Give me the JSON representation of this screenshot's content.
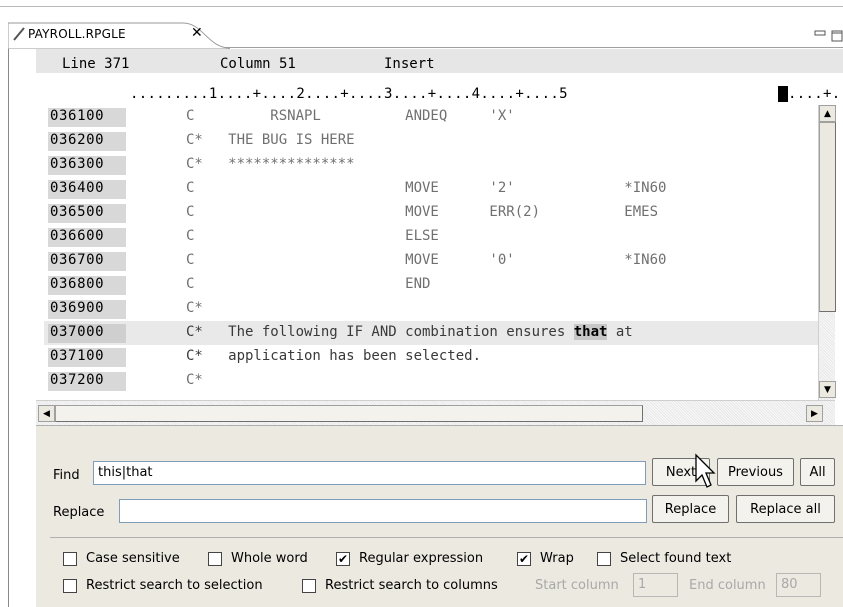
{
  "tab": {
    "title": "PAYROLL.RPGLE",
    "close": "✕"
  },
  "status": {
    "line": "Line 371",
    "column": "Column 51",
    "mode": "Insert"
  },
  "ruler": ".........1....+....2....+....3....+....4....+....5",
  "ruler_tail": "....+...",
  "code_lines": [
    {
      "seq": "036100",
      "text": "C         RSNAPL          ANDEQ     'X'"
    },
    {
      "seq": "036200",
      "text": "C*   THE BUG IS HERE"
    },
    {
      "seq": "036300",
      "text": "C*   ***************"
    },
    {
      "seq": "036400",
      "text": "C                         MOVE      '2'             *IN60"
    },
    {
      "seq": "036500",
      "text": "C                         MOVE      ERR(2)          EMES"
    },
    {
      "seq": "036600",
      "text": "C                         ELSE"
    },
    {
      "seq": "036700",
      "text": "C                         MOVE      '0'             *IN60"
    },
    {
      "seq": "036800",
      "text": "C                         END"
    },
    {
      "seq": "036900",
      "text": "C*"
    },
    {
      "seq": "037000",
      "text_before": "C*   The following IF AND combination ensures ",
      "text_match": "that",
      "text_after": " at"
    },
    {
      "seq": "037100",
      "text": "C*   application has been selected."
    },
    {
      "seq": "037200",
      "text": "C*"
    }
  ],
  "find": {
    "find_label": "Find",
    "find_value": "this|that",
    "replace_label": "Replace",
    "replace_value": "",
    "next_button": "Next",
    "previous_button": "Previous",
    "all_button": "All",
    "replace_button": "Replace",
    "replace_all_button": "Replace all"
  },
  "options": {
    "case_sensitive": {
      "label": "Case sensitive",
      "checked": false
    },
    "whole_word": {
      "label": "Whole word",
      "checked": false
    },
    "regular_expression": {
      "label": "Regular expression",
      "checked": true
    },
    "wrap": {
      "label": "Wrap",
      "checked": true
    },
    "select_found_text": {
      "label": "Select found text",
      "checked": false
    },
    "restrict_selection": {
      "label": "Restrict search to selection",
      "checked": false
    },
    "restrict_columns": {
      "label": "Restrict search to columns",
      "checked": false
    },
    "start_column_label": "Start column",
    "start_column_value": "1",
    "end_column_label": "End column",
    "end_column_value": "80"
  },
  "icons": {
    "tab": "pencil-edit-icon",
    "minimize": "minimize-icon",
    "maximize": "maximize-icon",
    "scroll_up": "arrow-up-icon",
    "scroll_down": "arrow-down-icon",
    "scroll_left": "arrow-left-icon",
    "scroll_right": "arrow-right-icon",
    "pointer": "mouse-pointer-icon"
  },
  "colors": {
    "panel_bg": "#ece9e1",
    "highlight_line": "#e9e9e9",
    "sequence_bg": "#d8d8d8",
    "match_bg": "#c7c7c7"
  }
}
